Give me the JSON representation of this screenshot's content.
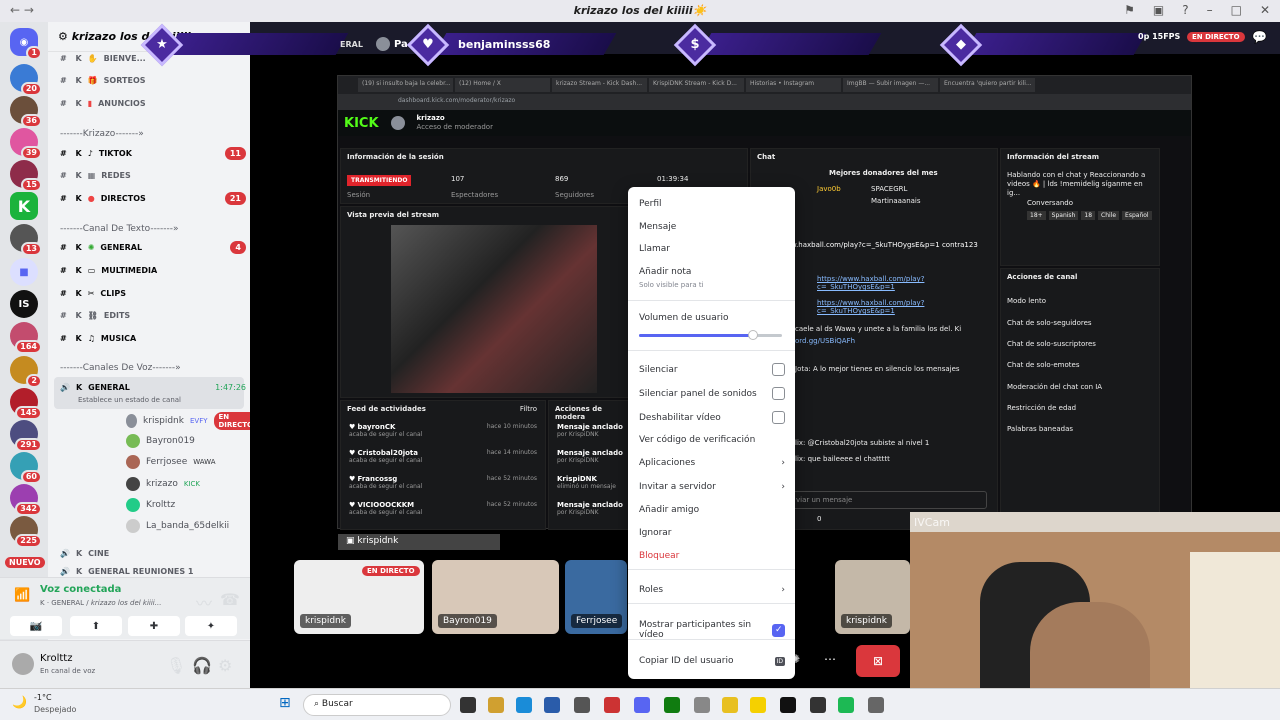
{
  "window": {
    "title": "krizazo los del kiiiii☀️"
  },
  "servers": [
    {
      "badge": "1"
    },
    {
      "badge": "20"
    },
    {
      "badge": "36"
    },
    {
      "badge": "39"
    },
    {
      "badge": "15"
    },
    {
      "badge": ""
    },
    {
      "badge": "13"
    },
    {
      "badge": ""
    },
    {
      "badge": ""
    },
    {
      "badge": "164"
    },
    {
      "badge": "2"
    },
    {
      "badge": "145"
    },
    {
      "badge": "291"
    },
    {
      "badge": "60"
    },
    {
      "badge": "342"
    },
    {
      "badge": "225"
    }
  ],
  "nuevo": "NUEVO",
  "server_name": "krizazo los del kiiiii",
  "channels": [
    {
      "label": "BIENVE...",
      "badge": ""
    },
    {
      "label": "SORTEOS",
      "badge": ""
    },
    {
      "label": "ANUNCIOS",
      "badge": ""
    },
    {
      "label": "TIKTOK",
      "badge": "11"
    },
    {
      "label": "REDES",
      "badge": ""
    },
    {
      "label": "DIRECTOS",
      "badge": "21"
    },
    {
      "label": "GENERAL",
      "badge": "4"
    },
    {
      "label": "MULTIMEDIA",
      "badge": ""
    },
    {
      "label": "CLIPS",
      "badge": ""
    },
    {
      "label": "EDITS",
      "badge": ""
    },
    {
      "label": "MUSICA",
      "badge": ""
    },
    {
      "label": "GENERAL",
      "badge": ""
    },
    {
      "label": "CINE",
      "badge": ""
    },
    {
      "label": "GENERAL REUNIONES 1",
      "badge": ""
    }
  ],
  "categories": [
    "-------Krizazo-------»",
    "-------Canal De Texto-------»",
    "-------Canales De Voz-------»"
  ],
  "channel_prefix": "K",
  "voice_timer": "1:47:26",
  "voice_status": "Establece un estado de canal",
  "voice_users": [
    {
      "name": "krispidnk",
      "tag": "EVFY",
      "live": "EN DIRECTO"
    },
    {
      "name": "Bayron019",
      "tag": "",
      "live": ""
    },
    {
      "name": "Ferrjosee",
      "tag": "WAWA",
      "live": ""
    },
    {
      "name": "krizazo",
      "tag": "KICK",
      "live": ""
    },
    {
      "name": "Krolttz",
      "tag": "",
      "live": ""
    },
    {
      "name": "La_banda_65delkii",
      "tag": "",
      "live": ""
    }
  ],
  "voice_panel": {
    "title": "Voz conectada",
    "sub_k": "K",
    "sub_ch": "GENERAL",
    "sub_server": "krizazo los del kiiii..."
  },
  "user_panel": {
    "name": "Krolttz",
    "status": "En canal de voz"
  },
  "stream": {
    "banner_name": "benjaminsss68",
    "fps": "0p 15FPS",
    "live": "EN DIRECTO",
    "top_left_text": "ERAL",
    "top_left_name": "Pa",
    "banner_icons": [
      "★",
      "♥",
      "$",
      "◆"
    ]
  },
  "browser": {
    "tabs": [
      "(19) si insulto baja la celebr...",
      "(12) Home / X",
      "krizazo Stream - Kick Dash...",
      "KrispiDNK Stream - Kick D...",
      "Historias • Instagram",
      "ImgBB — Subir imagen —...",
      "Encuentra 'quiero partir kili..."
    ],
    "url": "dashboard.kick.com/moderator/krizazo",
    "kick_user": "krizazo",
    "kick_role": "Acceso de moderador",
    "kick_logo": "KICK"
  },
  "session": {
    "title": "Información de la sesión",
    "status": "TRANSMITIENDO",
    "viewers": "107",
    "viewers_label": "Espectadores",
    "followers": "869",
    "followers_label": "Seguidores",
    "time": "01:39:34",
    "session_label": "Sesión",
    "preview_title": "Vista previa del stream"
  },
  "feed": {
    "title": "Feed de actividades",
    "filter": "Filtro",
    "items": [
      {
        "name": "bayronCK",
        "action": "acaba de seguir el canal",
        "time": "hace 10 minutos"
      },
      {
        "name": "Cristobal20jota",
        "action": "acaba de seguir el canal",
        "time": "hace 14 minutos"
      },
      {
        "name": "Francossg",
        "action": "acaba de seguir el canal",
        "time": "hace 52 minutos"
      },
      {
        "name": "VICIOOOCKKM",
        "action": "acaba de seguir el canal",
        "time": "hace 52 minutos"
      }
    ]
  },
  "mod_actions": {
    "title": "Acciones de modera",
    "items": [
      {
        "a": "Mensaje anclado",
        "b": "por KrispiDNK"
      },
      {
        "a": "Mensaje anclado",
        "b": "por KrispiDNK"
      },
      {
        "a": "KrispiDNK",
        "b": "eliminó un mensaje"
      },
      {
        "a": "Mensaje anclado",
        "b": "por KrispiDNK"
      }
    ]
  },
  "chat": {
    "title": "Chat",
    "top_title": "Mejores donadores del mes",
    "donors": [
      "Javo0b",
      "SPACEGRL",
      "Martinaaanais"
    ],
    "lines": [
      "w.haxball.com/play?c=_SkuTHOygsE&p=1 contra123",
      "https://www.haxball.com/play?c=_SkuTHOygsE&p=1",
      "https://www.haxball.com/play?c=_SkuTHOygsE&p=1",
      "caele al ds Wawa y unete a la familia los del. Ki",
      "ord.gg/USBiQAFh",
      "Jota: A lo mejor tienes en silencio los mensajes",
      "lix: @Cristobal20jota subiste al nivel 1",
      "lix: que baileeee el chattttt"
    ],
    "input": "viar un mensaje",
    "count": "0"
  },
  "stream_info": {
    "title": "Información del stream",
    "text": "Hablando con el chat y Reaccionando a videos 🔥 | lds !memidelig síganme en ig...",
    "category": "Conversando",
    "tags": [
      "18+",
      "Spanish",
      "18",
      "Chile",
      "Español"
    ]
  },
  "channel_actions": {
    "title": "Acciones de canal",
    "items": [
      "Modo lento",
      "Chat de solo-seguidores",
      "Chat de solo-suscriptores",
      "Chat de solo-emotes",
      "Moderación del chat con IA",
      "Restricción de edad",
      "Palabras baneadas"
    ]
  },
  "context_menu": {
    "perfil": "Perfil",
    "mensaje": "Mensaje",
    "llamar": "Llamar",
    "nota": "Añadir nota",
    "nota_sub": "Solo visible para ti",
    "volumen": "Volumen de usuario",
    "volume_level": 0.8,
    "silenciar": "Silenciar",
    "silenciar_sonidos": "Silenciar panel de sonidos",
    "deshabilitar": "Deshabilitar vídeo",
    "verificacion": "Ver código de verificación",
    "aplicaciones": "Aplicaciones",
    "invitar": "Invitar a servidor",
    "amigo": "Añadir amigo",
    "ignorar": "Ignorar",
    "bloquear": "Bloquear",
    "roles": "Roles",
    "mostrar": "Mostrar participantes sin vídeo",
    "copiar": "Copiar ID del usuario",
    "id_badge": "ID"
  },
  "tiles": [
    {
      "name": "krispidnk",
      "live": "EN DIRECTO"
    },
    {
      "name": "Bayron019",
      "live": ""
    },
    {
      "name": "Ferrjosee",
      "live": ""
    },
    {
      "name": "krispidnk",
      "live": ""
    }
  ],
  "share_label": "krispidnk",
  "camera_label": "IVCam",
  "taskbar": {
    "weather_temp": "-1°C",
    "weather_desc": "Despejado",
    "search": "Buscar"
  },
  "colors": {
    "discord_blurple": "#5865f2",
    "kick_green": "#53fc18",
    "live_red": "#da373c",
    "danger": "#da373c"
  }
}
